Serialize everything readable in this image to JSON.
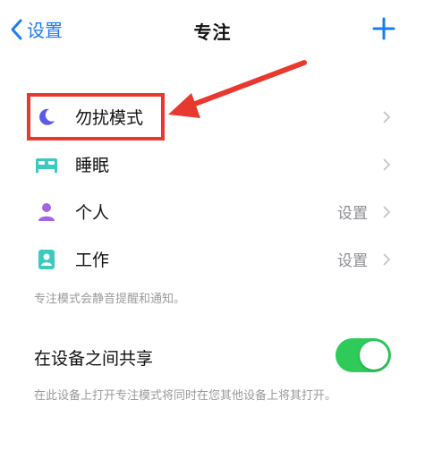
{
  "nav": {
    "back_label": "设置",
    "title": "专注",
    "add_icon": "plus-icon"
  },
  "focus_modes": [
    {
      "label": "勿扰模式",
      "value": "",
      "icon": "moon-icon",
      "icon_color": "#5b5ce6"
    },
    {
      "label": "睡眠",
      "value": "",
      "icon": "bed-icon",
      "icon_color": "#3cc9c0"
    },
    {
      "label": "个人",
      "value": "设置",
      "icon": "person-icon",
      "icon_color": "#a463e0"
    },
    {
      "label": "工作",
      "value": "设置",
      "icon": "id-badge-icon",
      "icon_color": "#3cc9c0"
    }
  ],
  "footer_note": "专注模式会静音提醒和通知。",
  "share": {
    "label": "在设备之间共享",
    "enabled": true,
    "note": "在此设备上打开专注模式将同时在您其他设备上将其打开。"
  },
  "colors": {
    "accent": "#1e7cf2",
    "toggle_on": "#2fcb5a",
    "annotation": "#e8392f"
  }
}
